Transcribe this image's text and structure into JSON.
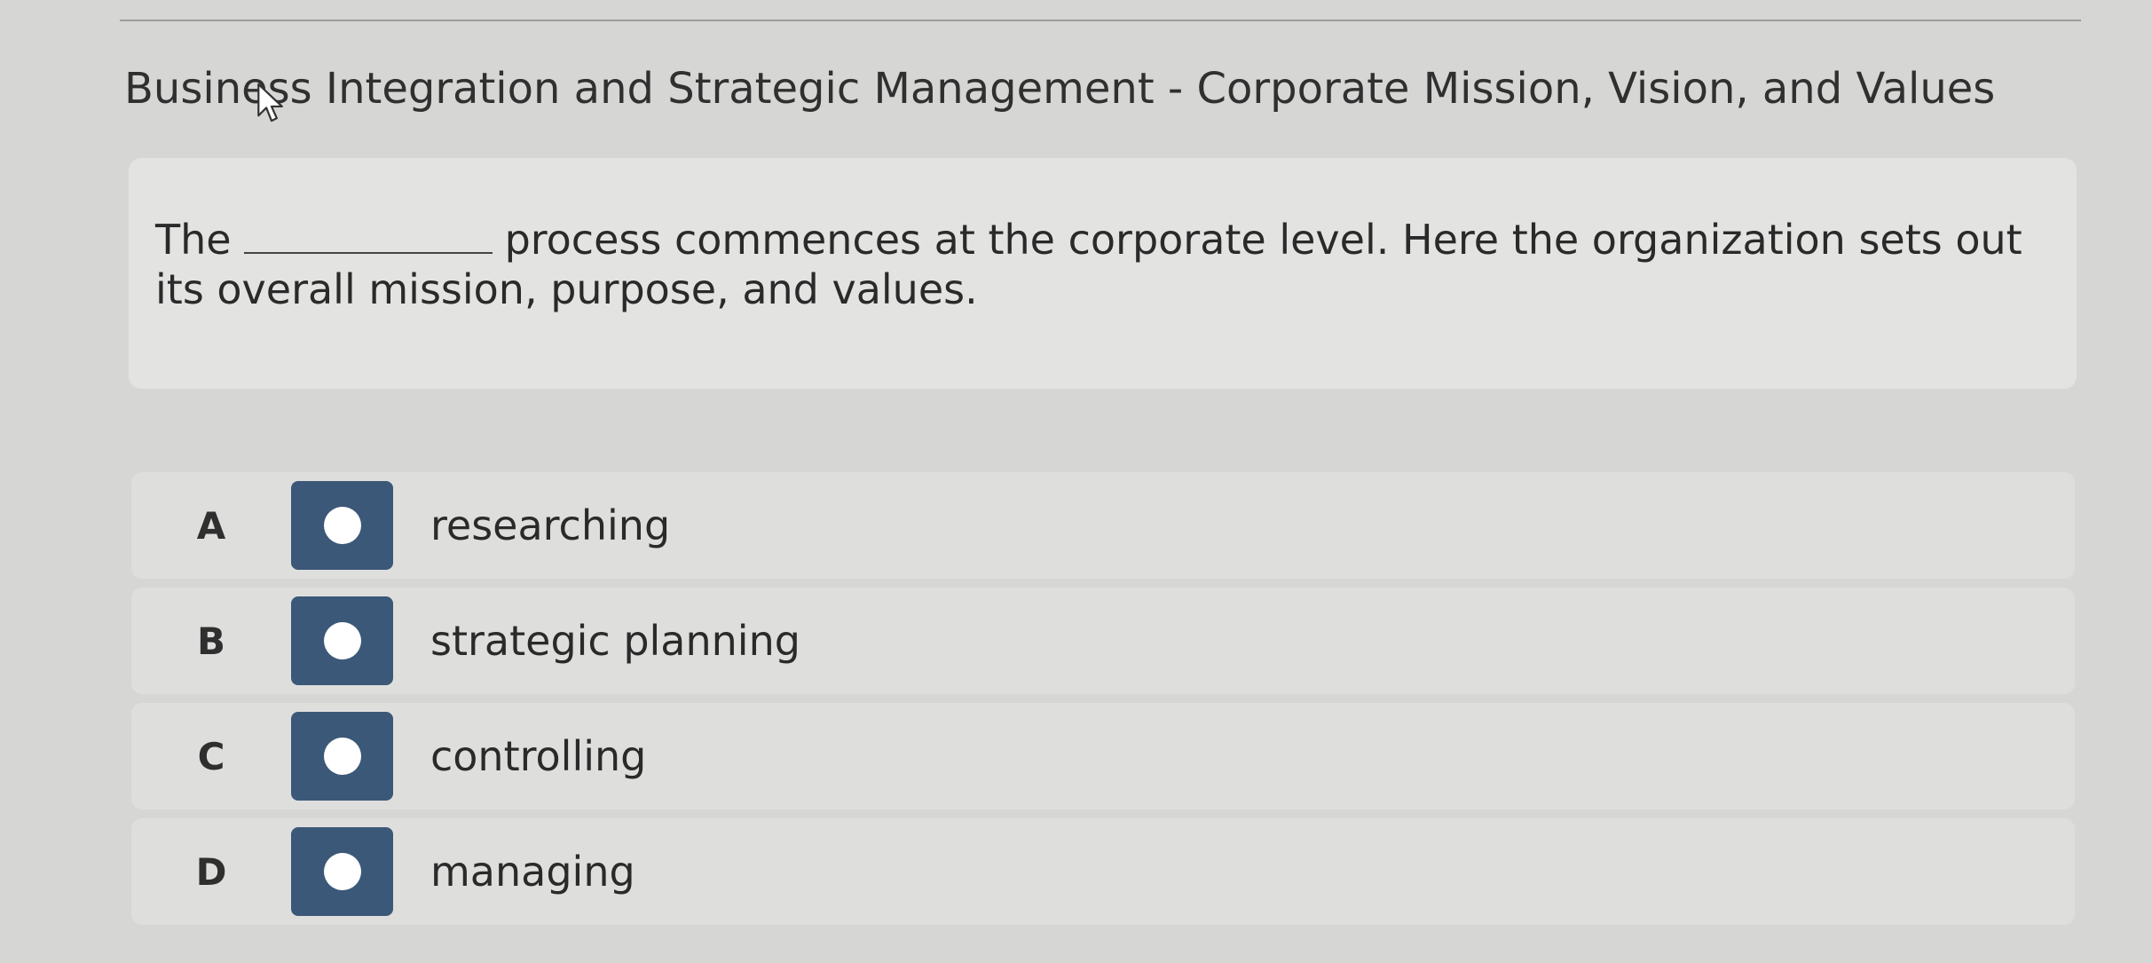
{
  "header": {
    "title": "Business Integration and Strategic Management - Corporate Mission, Vision, and Values"
  },
  "question": {
    "before_blank": "The",
    "after_blank": "process commences at the corporate level. Here the organization sets out its overall mission, purpose, and values."
  },
  "options": [
    {
      "letter": "A",
      "label": "researching"
    },
    {
      "letter": "B",
      "label": "strategic planning"
    },
    {
      "letter": "C",
      "label": "controlling"
    },
    {
      "letter": "D",
      "label": "managing"
    }
  ],
  "colors": {
    "radio_box": "#3b5878",
    "card_background": "#e3e4e2",
    "page_background": "#d6d7d5"
  },
  "icons": {
    "cursor": "mouse-pointer-icon",
    "radio": "radio-button-icon"
  }
}
